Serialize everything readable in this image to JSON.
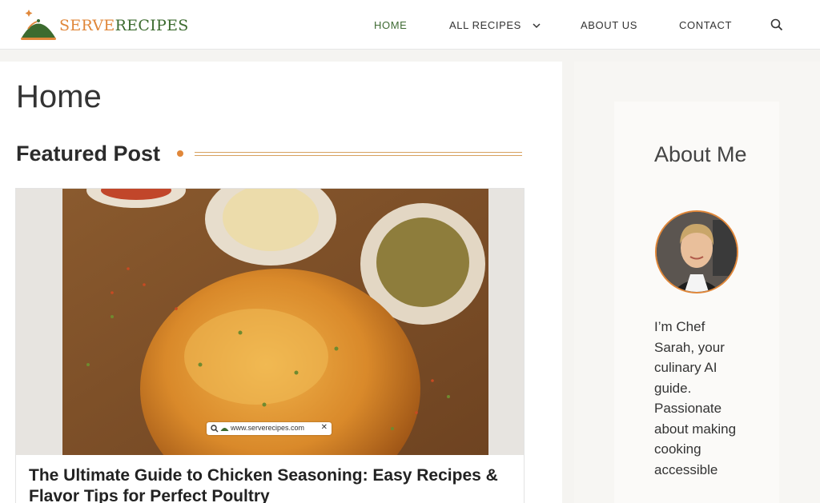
{
  "brand": {
    "word1": "SERVE",
    "word2": "RECIPES"
  },
  "nav": {
    "items": [
      {
        "label": "HOME",
        "active": true
      },
      {
        "label": "ALL RECIPES",
        "has_dropdown": true
      },
      {
        "label": "ABOUT US"
      },
      {
        "label": "CONTACT"
      }
    ],
    "search_icon": "search-icon"
  },
  "main": {
    "page_title": "Home",
    "section_title": "Featured Post",
    "featured": {
      "title": "The Ultimate Guide to Chicken Seasoning: Easy Recipes & Flavor Tips for Perfect Poultry",
      "image_url_badge": "www.serverecipes.com"
    }
  },
  "sidebar": {
    "about_title": "About Me",
    "about_text": "I’m Chef Sarah, your culinary AI guide. Passionate about making cooking accessible"
  },
  "colors": {
    "accent": "#e0873a",
    "brand_green": "#3c6b2f",
    "nav_active": "#3f6b34"
  }
}
